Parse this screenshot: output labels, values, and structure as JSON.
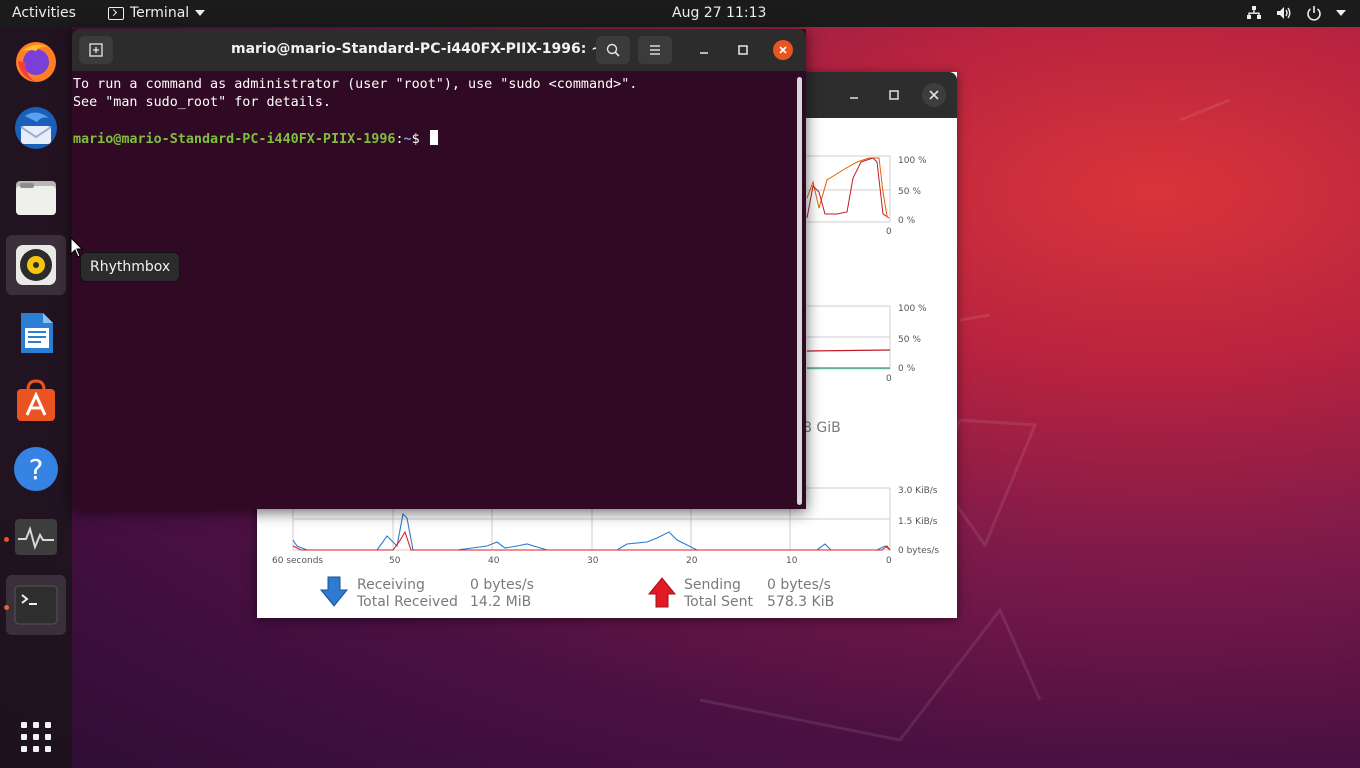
{
  "topbar": {
    "activities": "Activities",
    "app_name": "Terminal",
    "clock": "Aug 27  11:13"
  },
  "dock": {
    "items": [
      "Firefox",
      "Thunderbird Mail",
      "Files",
      "Rhythmbox",
      "LibreOffice Writer",
      "Ubuntu Software",
      "Help",
      "System Monitor",
      "Terminal"
    ],
    "show_apps": "Show Applications"
  },
  "tooltip": {
    "text": "Rhythmbox"
  },
  "terminal": {
    "title": "mario@mario-Standard-PC-i440FX-PIIX-1996: ~",
    "lines": [
      "To run a command as administrator (user \"root\"), use \"sudo <command>\".",
      "See \"man sudo_root\" for details."
    ],
    "prompt_user": "mario@mario-Standard-PC-i440FX-PIIX-1996",
    "prompt_sep": ":",
    "prompt_path": "~",
    "prompt_symbol": "$ "
  },
  "sysmon": {
    "cpu_axis": [
      "100 %",
      "50 %",
      "0 %",
      "0"
    ],
    "mem_axis": [
      "100 %",
      "50 %",
      "0 %",
      "0"
    ],
    "mem_fragment": "8 GiB",
    "net_axis": [
      "3.0 KiB/s",
      "1.5 KiB/s",
      "0 bytes/s"
    ],
    "time_axis": [
      "60 seconds",
      "50",
      "40",
      "30",
      "20",
      "10",
      "0"
    ],
    "receiving_label": "Receiving",
    "receiving_value": "0 bytes/s",
    "total_received_label": "Total Received",
    "total_received_value": "14.2 MiB",
    "sending_label": "Sending",
    "sending_value": "0 bytes/s",
    "total_sent_label": "Total Sent",
    "total_sent_value": "578.3 KiB",
    "colors": {
      "receiving": "#2e7bcf",
      "sending": "#e01b24",
      "cpu1": "#e66100",
      "cpu2": "#c01c28"
    }
  }
}
